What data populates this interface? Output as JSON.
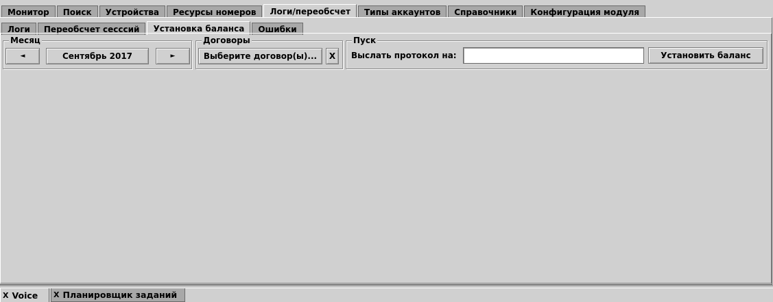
{
  "main_tabs": [
    {
      "label": "Монитор"
    },
    {
      "label": "Поиск"
    },
    {
      "label": "Устройства"
    },
    {
      "label": "Ресурсы номеров"
    },
    {
      "label": "Логи/переобсчет"
    },
    {
      "label": "Типы аккаунтов"
    },
    {
      "label": "Справочники"
    },
    {
      "label": "Конфигурация модуля"
    }
  ],
  "sub_tabs": [
    {
      "label": "Логи"
    },
    {
      "label": "Переобсчет сесссий"
    },
    {
      "label": "Установка баланса"
    },
    {
      "label": "Ошибки"
    }
  ],
  "month_group": {
    "title": "Месяц",
    "prev_icon": "◄",
    "value": "Сентябрь 2017",
    "next_icon": "►"
  },
  "contracts_group": {
    "title": "Договоры",
    "select_label": "Выберите договор(ы)...",
    "clear_icon": "X"
  },
  "launch_group": {
    "title": "Пуск",
    "send_label": "Выслать протокол на:",
    "email_value": "",
    "set_balance_label": "Установить баланс"
  },
  "bottom_tabs": [
    {
      "close": "X",
      "label": "Voice"
    },
    {
      "close": "X",
      "label": "Планировщик заданий"
    }
  ]
}
